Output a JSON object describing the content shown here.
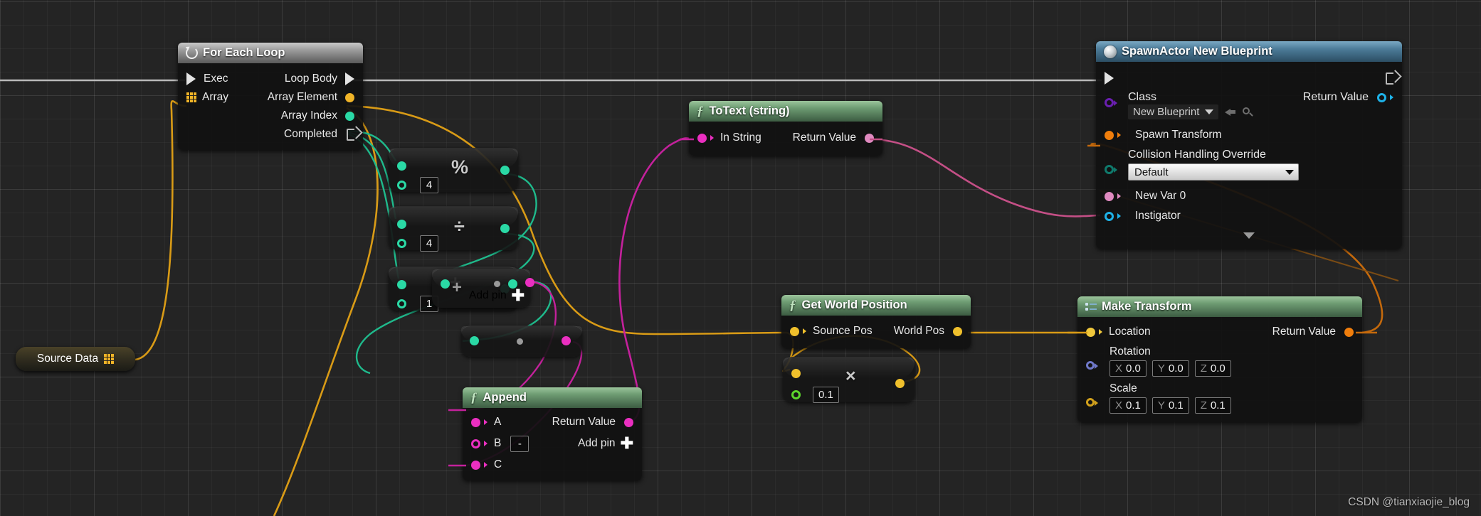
{
  "graph": {
    "background": "#242424",
    "watermark": "CSDN @tianxiaojie_blog"
  },
  "nodes": {
    "for_each_loop": {
      "title": "For Each Loop",
      "icon": "loop-icon",
      "inputs": [
        {
          "label": "Exec",
          "type": "exec"
        },
        {
          "label": "Array",
          "type": "array",
          "color": "#f0b428"
        }
      ],
      "outputs": [
        {
          "label": "Loop Body",
          "type": "exec"
        },
        {
          "label": "Array Element",
          "type": "wildcard",
          "color": "#f0b428"
        },
        {
          "label": "Array Index",
          "type": "int",
          "color": "#2ad9a5"
        },
        {
          "label": "Completed",
          "type": "exec"
        }
      ]
    },
    "source_data": {
      "label": "Source Data",
      "icon": "array-grid-icon",
      "pin_color": "#f0b428"
    },
    "modulo": {
      "symbol": "%",
      "operation": "percent",
      "input_b_value": "4",
      "pin_color": "#2ad9a5"
    },
    "divide": {
      "symbol": "÷",
      "operation": "divide",
      "input_b_value": "4",
      "pin_color": "#2ad9a5"
    },
    "add": {
      "symbol": "+",
      "operation": "add",
      "input_b_value": "1",
      "add_pin_label": "Add pin",
      "pin_color": "#2ad9a5"
    },
    "concat_small": {
      "symbol": "+",
      "add_pin_label": "Add pin",
      "pin_color": "#2ad9a5",
      "out_color": "#ea2fc0"
    },
    "lower_small": {
      "pin_color": "#2ad9a5",
      "out_color": "#ea2fc0"
    },
    "append": {
      "title": "Append",
      "icon": "function-icon",
      "inputs": [
        {
          "label": "A",
          "color": "#ea2fc0",
          "style": "solid"
        },
        {
          "label": "B",
          "color": "#ea2fc0",
          "style": "hollow",
          "value": "-"
        },
        {
          "label": "C",
          "color": "#ea2fc0",
          "style": "solid"
        }
      ],
      "outputs": [
        {
          "label": "Return Value",
          "color": "#ea2fc0"
        }
      ],
      "add_pin_label": "Add pin"
    },
    "to_text": {
      "title": "ToText (string)",
      "icon": "function-icon",
      "inputs": [
        {
          "label": "In String",
          "color": "#ea2fc0"
        }
      ],
      "outputs": [
        {
          "label": "Return Value",
          "color": "#e08ac0"
        }
      ]
    },
    "get_world_position": {
      "title": "Get World Position",
      "icon": "function-icon",
      "inputs": [
        {
          "label": "Sounce Pos",
          "color": "#f0c02c"
        }
      ],
      "outputs": [
        {
          "label": "World Pos",
          "color": "#f0c02c"
        }
      ]
    },
    "multiply": {
      "symbol": "×",
      "operation": "multiply",
      "input_b_value": "0.1",
      "in_color": "#f0c02c",
      "b_color": "#5dd72c",
      "out_color": "#f0c02c"
    },
    "make_transform": {
      "title": "Make Transform",
      "icon": "transform-icon",
      "location_label": "Location",
      "rotation_label": "Rotation",
      "scale_label": "Scale",
      "return_label": "Return Value",
      "rotation": {
        "x": "0.0",
        "y": "0.0",
        "z": "0.0"
      },
      "scale": {
        "x": "0.1",
        "y": "0.1",
        "z": "0.1"
      },
      "axes": {
        "x": "X",
        "y": "Y",
        "z": "Z"
      }
    },
    "spawn_actor": {
      "title": "SpawnActor New Blueprint",
      "icon": "spawn-actor-icon",
      "class_label": "Class",
      "class_value": "New Blueprint",
      "browse_icon": "browse-back-icon",
      "search_icon": "search-icon",
      "spawn_transform_label": "Spawn Transform",
      "collision_label": "Collision Handling Override",
      "collision_value": "Default",
      "new_var_label": "New Var 0",
      "instigator_label": "Instigator",
      "return_label": "Return Value",
      "expand_icon": "chevron-down-icon"
    }
  }
}
